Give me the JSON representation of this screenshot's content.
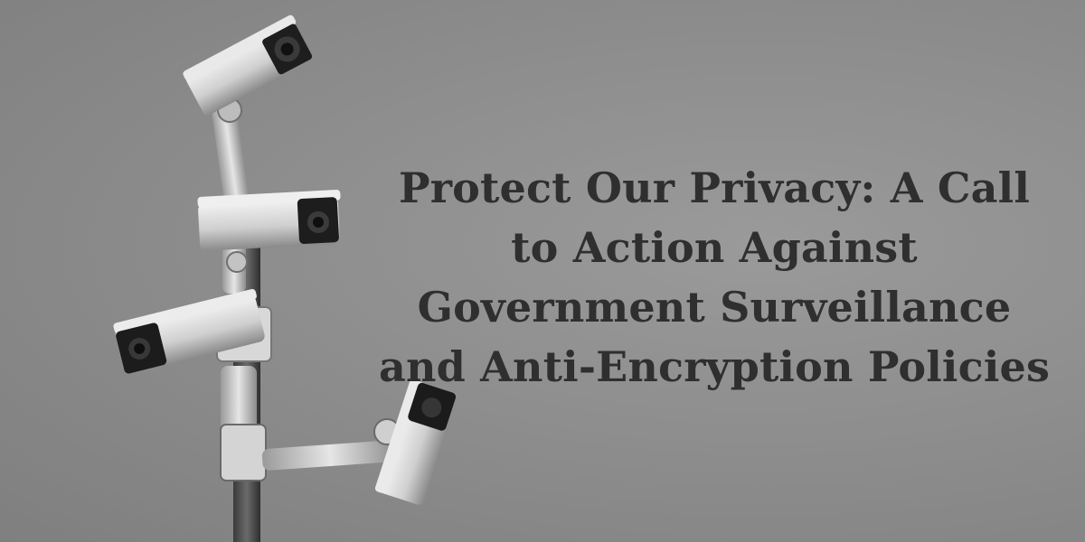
{
  "banner": {
    "title": "Protect Our Privacy: A Call to Action Against Government Surveillance and Anti-Encryption Policies"
  },
  "photo": {
    "subject": "cctv-camera-cluster",
    "palette": {
      "sky": "#8e8e8e",
      "housing": "#d9d9d9",
      "shadow": "#1e1e1e",
      "text": "#2f2f2f"
    }
  }
}
